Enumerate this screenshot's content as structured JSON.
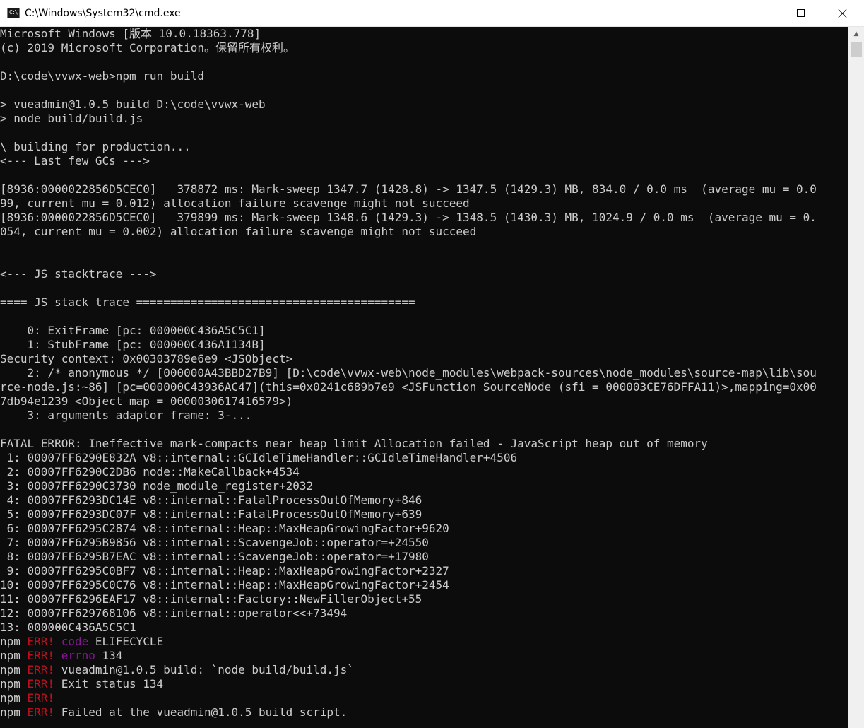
{
  "window": {
    "title": "C:\\Windows\\System32\\cmd.exe",
    "icon_text": "C:\\",
    "controls": {
      "minimize": "minimize",
      "maximize": "maximize",
      "close": "close"
    }
  },
  "colors": {
    "background": "#0c0c0c",
    "text": "#cccccc",
    "error": "#c50f1f",
    "keyword": "#881798",
    "titlebar": "#ffffff"
  },
  "console": {
    "lines": [
      [
        "Microsoft Windows [版本 10.0.18363.778]"
      ],
      [
        "(c) 2019 Microsoft Corporation。保留所有权利。"
      ],
      [
        ""
      ],
      [
        "D:\\code\\vvwx-web>npm run build"
      ],
      [
        ""
      ],
      [
        "> vueadmin@1.0.5 build D:\\code\\vvwx-web"
      ],
      [
        "> node build/build.js"
      ],
      [
        ""
      ],
      [
        "\\ building for production..."
      ],
      [
        "<--- Last few GCs --->"
      ],
      [
        ""
      ],
      [
        "[8936:0000022856D5CEC0]   378872 ms: Mark-sweep 1347.7 (1428.8) -> 1347.5 (1429.3) MB, 834.0 / 0.0 ms  (average mu = 0.0"
      ],
      [
        "99, current mu = 0.012) allocation failure scavenge might not succeed"
      ],
      [
        "[8936:0000022856D5CEC0]   379899 ms: Mark-sweep 1348.6 (1429.3) -> 1348.5 (1430.3) MB, 1024.9 / 0.0 ms  (average mu = 0."
      ],
      [
        "054, current mu = 0.002) allocation failure scavenge might not succeed"
      ],
      [
        ""
      ],
      [
        ""
      ],
      [
        "<--- JS stacktrace --->"
      ],
      [
        ""
      ],
      [
        "==== JS stack trace ========================================="
      ],
      [
        ""
      ],
      [
        "    0: ExitFrame [pc: 000000C436A5C5C1]"
      ],
      [
        "    1: StubFrame [pc: 000000C436A1134B]"
      ],
      [
        "Security context: 0x00303789e6e9 <JSObject>"
      ],
      [
        "    2: /* anonymous */ [000000A43BBD27B9] [D:\\code\\vvwx-web\\node_modules\\webpack-sources\\node_modules\\source-map\\lib\\sou"
      ],
      [
        "rce-node.js:~86] [pc=000000C43936AC47](this=0x0241c689b7e9 <JSFunction SourceNode (sfi = 000003CE76DFFA11)>,mapping=0x00"
      ],
      [
        "7db94e1239 <Object map = 0000030617416579>)"
      ],
      [
        "    3: arguments adaptor frame: 3-..."
      ],
      [
        ""
      ],
      [
        "FATAL ERROR: Ineffective mark-compacts near heap limit Allocation failed - JavaScript heap out of memory"
      ],
      [
        " 1: 00007FF6290E832A v8::internal::GCIdleTimeHandler::GCIdleTimeHandler+4506"
      ],
      [
        " 2: 00007FF6290C2DB6 node::MakeCallback+4534"
      ],
      [
        " 3: 00007FF6290C3730 node_module_register+2032"
      ],
      [
        " 4: 00007FF6293DC14E v8::internal::FatalProcessOutOfMemory+846"
      ],
      [
        " 5: 00007FF6293DC07F v8::internal::FatalProcessOutOfMemory+639"
      ],
      [
        " 6: 00007FF6295C2874 v8::internal::Heap::MaxHeapGrowingFactor+9620"
      ],
      [
        " 7: 00007FF6295B9856 v8::internal::ScavengeJob::operator=+24550"
      ],
      [
        " 8: 00007FF6295B7EAC v8::internal::ScavengeJob::operator=+17980"
      ],
      [
        " 9: 00007FF6295C0BF7 v8::internal::Heap::MaxHeapGrowingFactor+2327"
      ],
      [
        "10: 00007FF6295C0C76 v8::internal::Heap::MaxHeapGrowingFactor+2454"
      ],
      [
        "11: 00007FF6296EAF17 v8::internal::Factory::NewFillerObject+55"
      ],
      [
        "12: 00007FF629768106 v8::internal::operator<<+73494"
      ],
      [
        "13: 000000C436A5C5C1"
      ],
      [
        "npm ",
        "ERR!",
        " ",
        "code",
        " ELIFECYCLE"
      ],
      [
        "npm ",
        "ERR!",
        " ",
        "errno",
        " 134"
      ],
      [
        "npm ",
        "ERR!",
        " vueadmin@1.0.5 build: `node build/build.js`"
      ],
      [
        "npm ",
        "ERR!",
        " Exit status 134"
      ],
      [
        "npm ",
        "ERR!"
      ],
      [
        "npm ",
        "ERR!",
        " Failed at the vueadmin@1.0.5 build script."
      ]
    ]
  }
}
